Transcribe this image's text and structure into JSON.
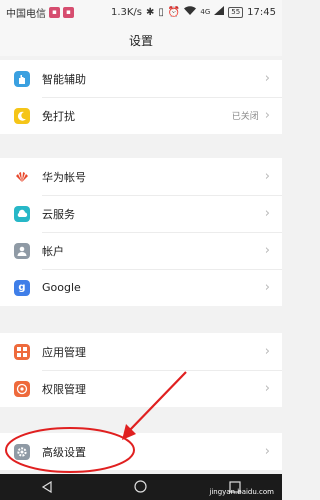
{
  "status_bar": {
    "carrier": "中国电信",
    "speed": "1.3K/s",
    "network": "4G",
    "battery": "55",
    "time": "17:45"
  },
  "header": {
    "title": "设置"
  },
  "groups": [
    {
      "items": [
        {
          "label": "智能辅助",
          "icon": "hand-icon",
          "color": "#3aa0e0"
        },
        {
          "label": "免打扰",
          "icon": "moon-icon",
          "color": "#f5c518",
          "value": "已关闭"
        }
      ]
    },
    {
      "items": [
        {
          "label": "华为帐号",
          "icon": "huawei-icon",
          "color": "#e8472b"
        },
        {
          "label": "云服务",
          "icon": "cloud-icon",
          "color": "#27b7c7"
        },
        {
          "label": "帐户",
          "icon": "person-icon",
          "color": "#8f9aa5"
        },
        {
          "label": "Google",
          "icon": "google-icon",
          "color": "#3f7ee8"
        }
      ]
    },
    {
      "items": [
        {
          "label": "应用管理",
          "icon": "grid-icon",
          "color": "#ee6a3c"
        },
        {
          "label": "权限管理",
          "icon": "shield-icon",
          "color": "#ee6a3c"
        }
      ]
    },
    {
      "items": [
        {
          "label": "高级设置",
          "icon": "gear-icon",
          "color": "#8f9aa5"
        }
      ]
    }
  ],
  "watermark": "jingyan.baidu.com"
}
